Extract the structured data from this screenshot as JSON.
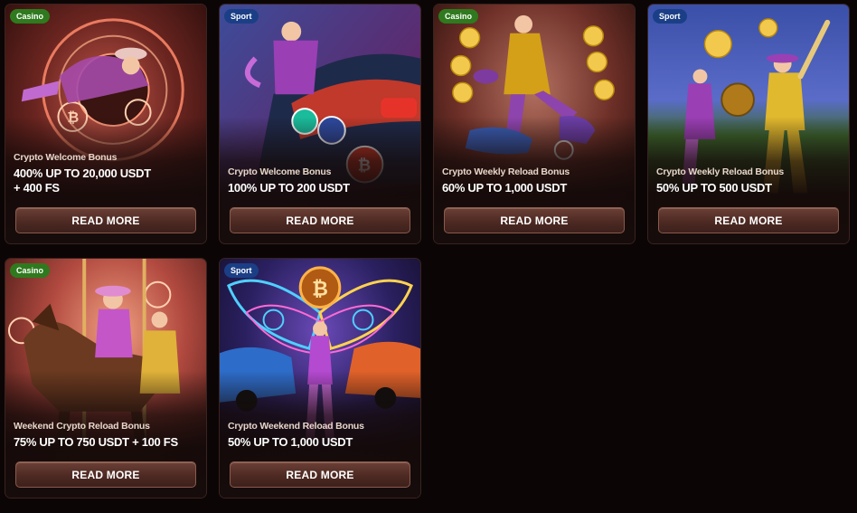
{
  "cards": [
    {
      "badge": "Casino",
      "subtitle": "Crypto Welcome Bonus",
      "headline_line1": "400% UP TO 20,000 USDT",
      "headline_line2": "+ 400 FS",
      "button": "READ MORE"
    },
    {
      "badge": "Sport",
      "subtitle": "Crypto Welcome Bonus",
      "headline_line1": "100% UP TO 200 USDT",
      "headline_line2": "",
      "button": "READ MORE"
    },
    {
      "badge": "Casino",
      "subtitle": "Crypto Weekly Reload Bonus",
      "headline_line1": "60% UP TO 1,000 USDT",
      "headline_line2": "",
      "button": "READ MORE"
    },
    {
      "badge": "Sport",
      "subtitle": "Crypto Weekly Reload Bonus",
      "headline_line1": "50% UP TO 500 USDT",
      "headline_line2": "",
      "button": "READ MORE"
    },
    {
      "badge": "Casino",
      "subtitle": "Weekend Crypto Reload Bonus",
      "headline_line1": "75% UP TO 750 USDT + 100 FS",
      "headline_line2": "",
      "button": "READ MORE"
    },
    {
      "badge": "Sport",
      "subtitle": "Crypto Weekend Reload Bonus",
      "headline_line1": "50% UP TO 1,000 USDT",
      "headline_line2": "",
      "button": "READ MORE"
    }
  ],
  "colors": {
    "page_background": "#0b0605",
    "casino_badge": "#2f7a1e",
    "sport_badge": "#1b3f86",
    "button": "#5a342b"
  }
}
